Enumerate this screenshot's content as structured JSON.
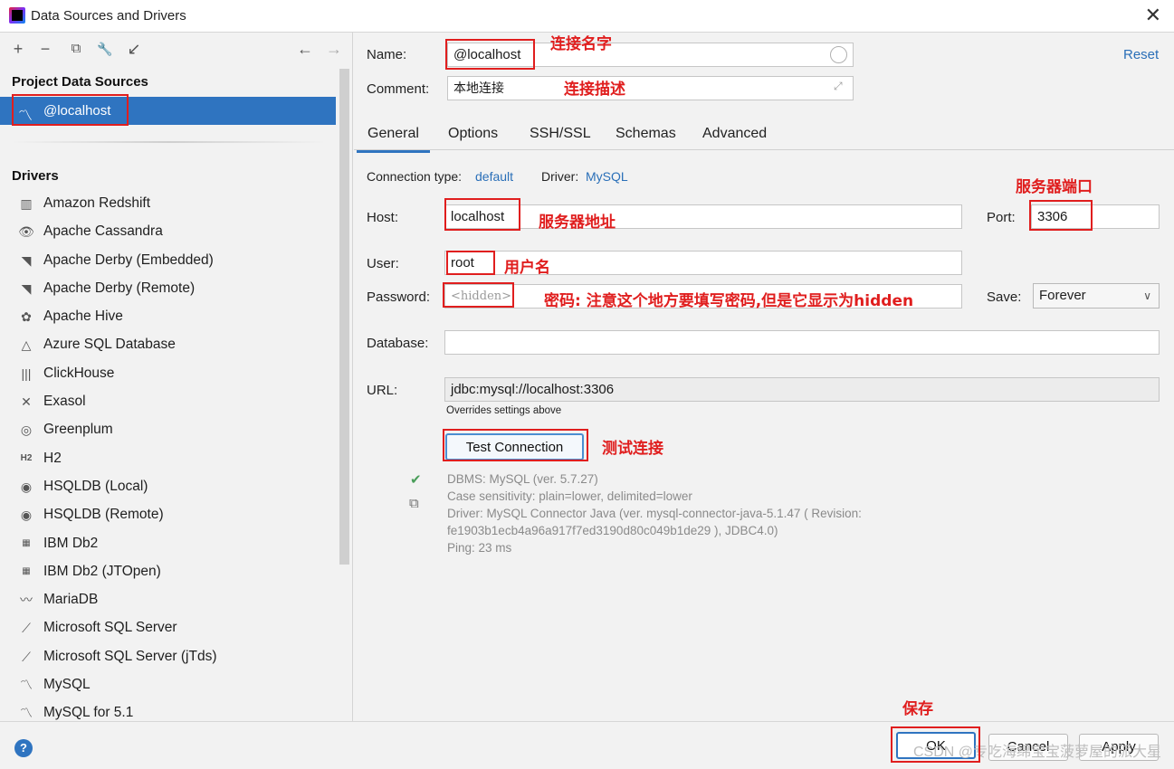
{
  "window": {
    "title": "Data Sources and Drivers",
    "close_glyph": "✕"
  },
  "left": {
    "toolbar": {
      "add": "+",
      "remove": "−",
      "duplicate": "⧉",
      "settings": "🔧",
      "import": "↙",
      "back": "←",
      "forward": "→"
    },
    "project_heading": "Project Data Sources",
    "data_source": {
      "label": "@localhost",
      "icon": "mysql-dolphin-icon"
    },
    "drivers_heading": "Drivers",
    "drivers": [
      {
        "label": "Amazon Redshift",
        "glyph": "▥"
      },
      {
        "label": "Apache Cassandra",
        "glyph": "👁"
      },
      {
        "label": "Apache Derby (Embedded)",
        "glyph": "◥"
      },
      {
        "label": "Apache Derby (Remote)",
        "glyph": "◥"
      },
      {
        "label": "Apache Hive",
        "glyph": "✿"
      },
      {
        "label": "Azure SQL Database",
        "glyph": "△"
      },
      {
        "label": "ClickHouse",
        "glyph": "|||"
      },
      {
        "label": "Exasol",
        "glyph": "✕"
      },
      {
        "label": "Greenplum",
        "glyph": "◎"
      },
      {
        "label": "H2",
        "glyph": "H2"
      },
      {
        "label": "HSQLDB (Local)",
        "glyph": "◉"
      },
      {
        "label": "HSQLDB (Remote)",
        "glyph": "◉"
      },
      {
        "label": "IBM Db2",
        "glyph": "▦"
      },
      {
        "label": "IBM Db2 (JTOpen)",
        "glyph": "▦"
      },
      {
        "label": "MariaDB",
        "glyph": "〰"
      },
      {
        "label": "Microsoft SQL Server",
        "glyph": "⟋"
      },
      {
        "label": "Microsoft SQL Server (jTds)",
        "glyph": "⟋"
      },
      {
        "label": "MySQL",
        "glyph": "〽"
      },
      {
        "label": "MySQL for 5.1",
        "glyph": "〽"
      }
    ]
  },
  "form": {
    "name_label": "Name:",
    "name_value": "@localhost",
    "comment_label": "Comment:",
    "comment_value": "本地连接",
    "reset": "Reset",
    "tabs": [
      "General",
      "Options",
      "SSH/SSL",
      "Schemas",
      "Advanced"
    ],
    "conn_type_label": "Connection type:",
    "conn_type_value": "default",
    "driver_label": "Driver:",
    "driver_value": "MySQL",
    "host_label": "Host:",
    "host_value": "localhost",
    "port_label": "Port:",
    "port_value": "3306",
    "user_label": "User:",
    "user_value": "root",
    "password_label": "Password:",
    "password_value": "<hidden>",
    "save_label": "Save:",
    "save_value": "Forever",
    "database_label": "Database:",
    "database_value": "",
    "url_label": "URL:",
    "url_value": "jdbc:mysql://localhost:3306",
    "overrides_note": "Overrides settings above",
    "test_button": "Test Connection",
    "test_result": [
      "DBMS: MySQL (ver. 5.7.27)",
      "Case sensitivity: plain=lower, delimited=lower",
      "Driver: MySQL Connector Java (ver. mysql-connector-java-5.1.47 ( Revision:",
      "fe1903b1ecb4a96a917f7ed3190d80c049b1de29 ), JDBC4.0)",
      "Ping: 23 ms"
    ]
  },
  "annotations": {
    "name": "连接名字",
    "comment": "连接描述",
    "port": "服务器端口",
    "host": "服务器地址",
    "user": "用户名",
    "password": "密码: 注意这个地方要填写密码,但是它显示为hidden",
    "test": "测试连接",
    "save": "保存"
  },
  "footer": {
    "help": "?",
    "ok": "OK",
    "cancel": "Cancel",
    "apply": "Apply",
    "watermark": "CSDN @专吃海绵宝宝菠萝屋的派大星"
  },
  "colors": {
    "accent": "#2f74c0",
    "annotation": "#e01e1e",
    "success": "#4a9e5a"
  }
}
